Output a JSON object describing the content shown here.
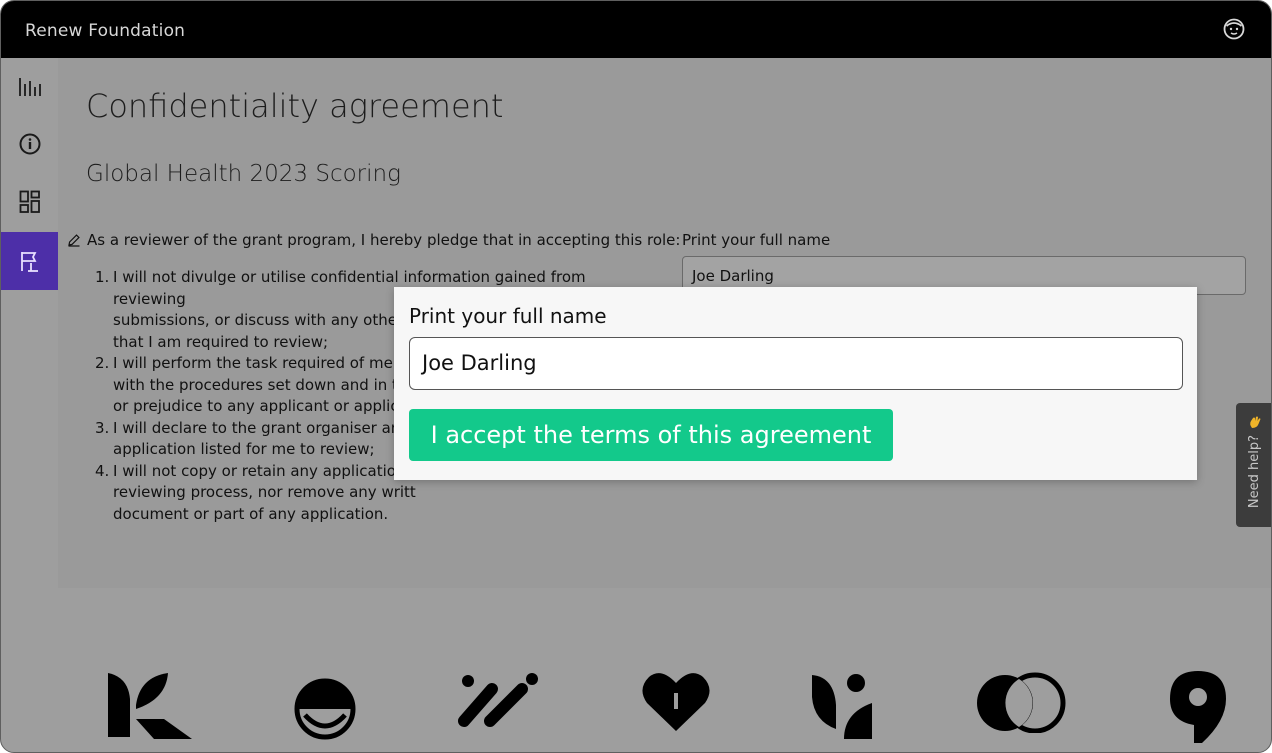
{
  "app": {
    "title": "Renew Foundation"
  },
  "colors": {
    "topbar": "#000000",
    "sidebar_active": "#4d2fa8",
    "accept_button": "#13c98b",
    "help_tab": "#3c3c3c"
  },
  "sidebar": {
    "items": [
      {
        "icon": "bar-chart-icon",
        "active": false
      },
      {
        "icon": "info-icon",
        "active": false
      },
      {
        "icon": "dashboard-icon",
        "active": false
      },
      {
        "icon": "flag-icon",
        "active": true
      }
    ]
  },
  "page": {
    "title": "Confidentiality agreement",
    "subtitle": "Global Health 2023 Scoring",
    "pledge_intro": "As a reviewer of the grant program, I hereby pledge that in accepting this role:",
    "pledge_items": [
      {
        "num": "1.",
        "lines": [
          "I will not divulge or utilise confidential information gained from reviewing",
          "submissions, or discuss with any other p",
          "that I am required to review;"
        ]
      },
      {
        "num": "2.",
        "lines": [
          "I will perform the task required of me to",
          "with the procedures set down and in the",
          "or prejudice to any applicant or applicati"
        ]
      },
      {
        "num": "3.",
        "lines": [
          "I will declare to the grant organiser any i",
          "application listed for me to review;"
        ]
      },
      {
        "num": "4.",
        "lines": [
          "I will not copy or retain any application m",
          "reviewing process, nor remove any writt",
          "document or part of any application."
        ]
      }
    ],
    "name_label": "Print your full name",
    "name_value": "Joe Darling"
  },
  "modal": {
    "label": "Print your full name",
    "input_value": "Joe Darling",
    "accept_label": "I accept the terms of this agreement"
  },
  "help": {
    "label": "Need help?"
  }
}
